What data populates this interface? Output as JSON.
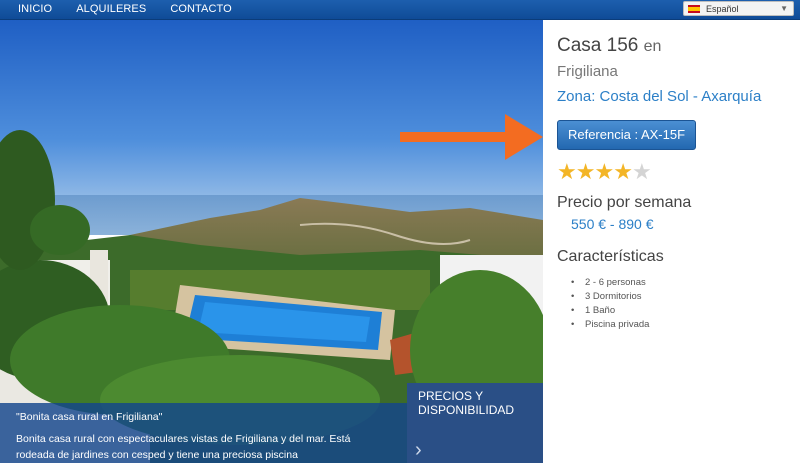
{
  "nav": {
    "items": [
      "INICIO",
      "ALQUILERES",
      "CONTACTO"
    ]
  },
  "language": {
    "selected": "Español"
  },
  "property": {
    "title": "Casa 156",
    "title_connector": "en",
    "town": "Frigiliana",
    "zone": "Zona: Costa del Sol - Axarquía",
    "reference_label": "Referencia : AX-15F",
    "rating": {
      "filled": 4,
      "max": 5
    },
    "price_heading": "Precio por semana",
    "price_range": "550 € - 890 €",
    "features_heading": "Características",
    "features": [
      "2 - 6 personas",
      "3 Dormitorios",
      "1 Baño",
      "Piscina privada"
    ]
  },
  "caption": {
    "title": "\"Bonita casa rural en Frigiliana\"",
    "description": "Bonita casa rural con espectaculares vistas de Frigiliana y del mar. Está rodeada de jardines con cesped y tiene una preciosa piscina"
  },
  "prices_panel": {
    "label": "PRECIOS Y DISPONIBILIDAD"
  },
  "colors": {
    "accent": "#2b7fc7",
    "nav": "#1d5fae",
    "arrow": "#f36c21",
    "star": "#f3b526"
  }
}
